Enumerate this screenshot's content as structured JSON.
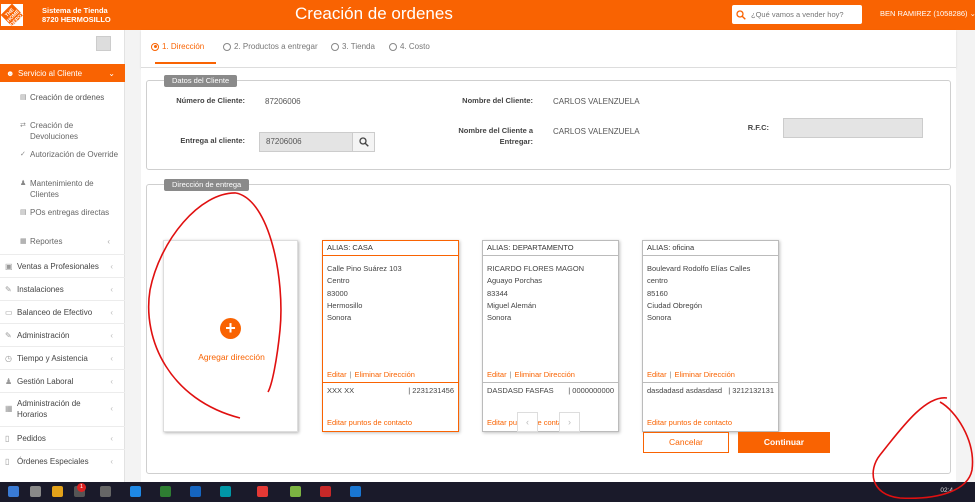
{
  "header": {
    "store_line1": "Sistema de Tienda",
    "store_line2": "8720 HERMOSILLO",
    "title": "Creación de ordenes",
    "search_placeholder": "¿Qué vamos a vender hoy?",
    "user": "BEN RAMIREZ (1058286)",
    "brand_color": "#f96302"
  },
  "sidebar": {
    "section": "Servicio al Cliente",
    "subitems": [
      {
        "label": "Creación de ordenes",
        "icon": "list-icon"
      },
      {
        "label": "Creación de Devoluciones",
        "icon": "return-icon"
      },
      {
        "label": "Autorización de Override",
        "icon": "check-icon"
      },
      {
        "label": "Mantenimiento de Clientes",
        "icon": "user-icon"
      },
      {
        "label": "POs entregas directas",
        "icon": "list-icon"
      },
      {
        "label": "Reportes",
        "icon": "report-icon"
      }
    ],
    "items": [
      {
        "label": "Ventas a Profesionales",
        "icon": "briefcase-icon"
      },
      {
        "label": "Instalaciones",
        "icon": "wrench-icon"
      },
      {
        "label": "Balanceo de Efectivo",
        "icon": "cash-icon"
      },
      {
        "label": "Administración",
        "icon": "wrench-icon"
      },
      {
        "label": "Tiempo y Asistencia",
        "icon": "clock-icon"
      },
      {
        "label": "Gestión Laboral",
        "icon": "people-icon"
      },
      {
        "label": "Administración de Horarios",
        "icon": "calendar-icon"
      },
      {
        "label": "Pedidos",
        "icon": "document-icon"
      },
      {
        "label": "Órdenes Especiales",
        "icon": "document-icon"
      }
    ]
  },
  "steps": [
    {
      "label": "1. Dirección",
      "active": true
    },
    {
      "label": "2. Productos a entregar",
      "active": false
    },
    {
      "label": "3. Tienda",
      "active": false
    },
    {
      "label": "4. Costo",
      "active": false
    }
  ],
  "client": {
    "legend": "Datos del Cliente",
    "numero_label": "Número de Cliente:",
    "numero_value": "87206006",
    "entrega_label": "Entrega al cliente:",
    "entrega_value": "87206006",
    "nombre_label": "Nombre del Cliente:",
    "nombre_value": "CARLOS VALENZUELA",
    "nombre_entregar_label": "Nombre del Cliente a Entregar:",
    "nombre_entregar_value": "CARLOS VALENZUELA",
    "rfc_label": "R.F.C:",
    "rfc_value": ""
  },
  "delivery": {
    "legend": "Dirección de entrega",
    "add_label": "Agregar dirección",
    "add_symbol": "+",
    "cards": [
      {
        "alias": "ALIAS: CASA",
        "selected": true,
        "lines": [
          "Calle Pino Suárez 103",
          "Centro",
          "83000",
          "Hermosillo",
          "Sonora"
        ],
        "edit": "Editar",
        "sep": "|",
        "delete": "Eliminar Dirección",
        "contact_name": "XXX XX",
        "contact_phone": "| 2231231456",
        "contact_link": "Editar puntos de contacto"
      },
      {
        "alias": "ALIAS: DEPARTAMENTO",
        "selected": false,
        "lines": [
          "RICARDO FLORES MAGON",
          "Aguayo Porchas",
          "83344",
          "Miguel Alemán",
          "Sonora"
        ],
        "edit": "Editar",
        "sep": "|",
        "delete": "Eliminar Dirección",
        "contact_name": "DASDASD FASFAS",
        "contact_phone": "| 0000000000",
        "contact_link": "Editar puntos de contacto"
      },
      {
        "alias": "ALIAS: oficina",
        "selected": false,
        "lines": [
          "Boulevard Rodolfo Elías Calles",
          "centro",
          "85160",
          "Ciudad Obregón",
          "Sonora"
        ],
        "edit": "Editar",
        "sep": "|",
        "delete": "Eliminar Dirección",
        "contact_name": "dasdadasd asdasdasd",
        "contact_phone": "| 3212132131",
        "contact_link": "Editar puntos de contacto"
      }
    ],
    "pager_prev": "‹",
    "pager_next": "›"
  },
  "footer": {
    "cancel": "Cancelar",
    "continue": "Continuar"
  },
  "taskbar": {
    "badge": "1",
    "clock": "02:4"
  }
}
